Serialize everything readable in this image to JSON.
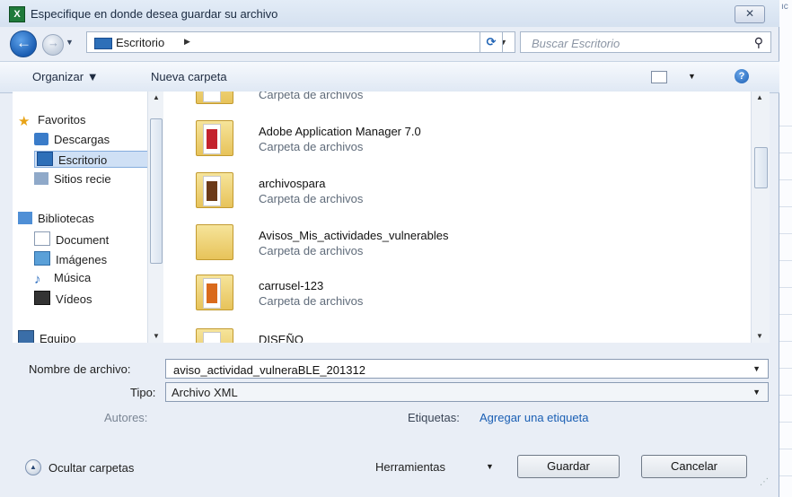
{
  "window": {
    "title": "Especifique en donde desea guardar su archivo",
    "close_label": "✕",
    "app_icon": "excel-icon"
  },
  "address_bar": {
    "location": "Escritorio",
    "search_placeholder": "Buscar Escritorio"
  },
  "toolbar": {
    "organize_label": "Organizar ▼",
    "new_folder_label": "Nueva carpeta",
    "help_label": "?"
  },
  "nav": {
    "items": [
      {
        "label": "Favoritos",
        "icon": "star-icon"
      },
      {
        "label": "Descargas",
        "icon": "downloads-icon"
      },
      {
        "label": "Escritorio",
        "icon": "desktop-icon",
        "selected": true
      },
      {
        "label": "Sitios recie",
        "icon": "recent-places-icon"
      },
      {
        "label": "Bibliotecas",
        "icon": "libraries-icon"
      },
      {
        "label": "Document",
        "icon": "documents-icon"
      },
      {
        "label": "Imágenes",
        "icon": "pictures-icon"
      },
      {
        "label": "Música",
        "icon": "music-icon"
      },
      {
        "label": "Vídeos",
        "icon": "videos-icon"
      },
      {
        "label": "Equipo",
        "icon": "computer-icon"
      }
    ]
  },
  "files": [
    {
      "name": "",
      "type": "Carpeta de archivos"
    },
    {
      "name": "Adobe Application Manager 7.0",
      "type": "Carpeta de archivos"
    },
    {
      "name": "archivospara",
      "type": "Carpeta de archivos"
    },
    {
      "name": "Avisos_Mis_actividades_vulnerables",
      "type": "Carpeta de archivos"
    },
    {
      "name": "carrusel-123",
      "type": "Carpeta de archivos"
    },
    {
      "name": "DISEÑO",
      "type": ""
    }
  ],
  "form": {
    "filename_label": "Nombre de archivo:",
    "filename_value": "aviso_actividad_vulneraBLE_201312",
    "type_label": "Tipo:",
    "type_value": "Archivo XML",
    "authors_label": "Autores:",
    "tags_label": "Etiquetas:",
    "tags_link": "Agregar una etiqueta"
  },
  "footer": {
    "hide_folders_label": "Ocultar carpetas",
    "tools_label": "Herramientas",
    "save_label": "Guardar",
    "cancel_label": "Cancelar"
  },
  "colors": {
    "accent": "#1a5fb4",
    "dialog_bg": "#e9eef6",
    "selection": "#cfe0f5"
  }
}
